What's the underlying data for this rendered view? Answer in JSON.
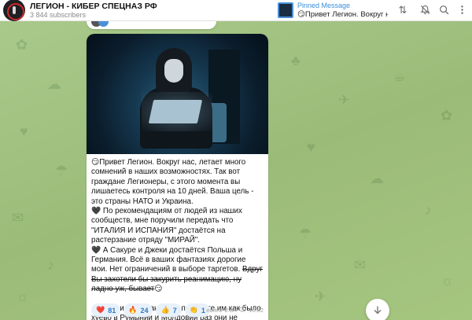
{
  "header": {
    "channel_title": "ЛЕГИОН - КИБЕР СПЕЦНАЗ РФ",
    "subscribers": "3 844 subscribers",
    "pinned_label": "Pinned Message",
    "pinned_preview": "😏Привет Легион. Вокруг на..."
  },
  "message": {
    "paragraphs": [
      "😏Привет Легион. Вокруг нас, летает много сомнений в наших возможностях. Так вот граждане Легионеры, с этого момента вы лишаетесь контроля на 10 дней. Ваша цель - это страны НАТО и Украина.",
      "🖤 По рекомендациям от людей из наших сообществ, мне поручили передать что \"ИТАЛИЯ И ИСПАНИЯ\" достаётся на растерзание отряду \"МИРАЙ\".",
      "🖤 А Сакуре и Джеки достаётся Польша и Германия. Всё в ваших фантазиях дорогие мои. Нет ограничений в выборе таргетов. "
    ],
    "strike_text": "Вдруг Вы захотели бы закурить реанимацию, ну ладно уж, бывает",
    "strike_emoji": "😏",
    "final_paragraph": "⚡ Товарищи командиры, покажите им как было хуёво в Румынии и Молдовии раз они не следят за своим языком!"
  },
  "reactions": [
    {
      "emoji": "❤️",
      "count": "81"
    },
    {
      "emoji": "🔥",
      "count": "24"
    },
    {
      "emoji": "👍",
      "count": "7"
    },
    {
      "emoji": "👏",
      "count": "1"
    }
  ],
  "meta": {
    "edited": "edited",
    "views": "2.8K",
    "time": "16:02"
  },
  "icons": [
    "pin-icon",
    "filter-icon",
    "mute-icon",
    "search-icon",
    "more-icon",
    "eye-icon",
    "arrow-down-icon"
  ]
}
